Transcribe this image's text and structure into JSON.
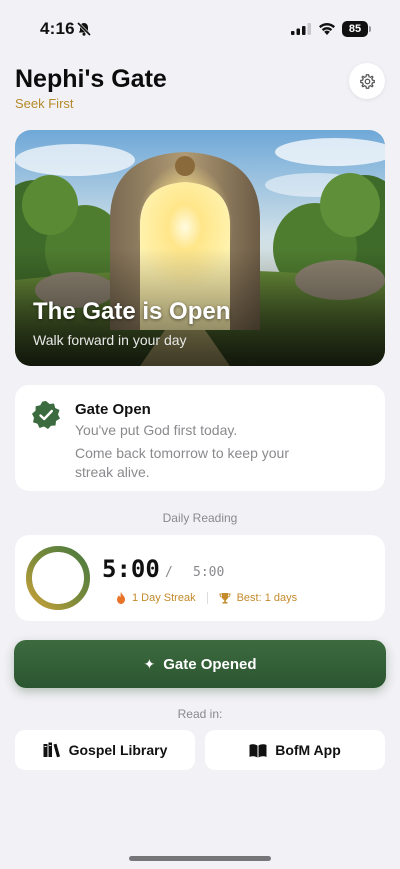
{
  "status_bar": {
    "time": "4:16",
    "battery": "85"
  },
  "header": {
    "title": "Nephi's Gate",
    "subtitle": "Seek First"
  },
  "hero": {
    "title": "The Gate is Open",
    "subtitle": "Walk forward in your day"
  },
  "status_card": {
    "title": "Gate Open",
    "line1": "You've put God first today.",
    "line2": "Come back tomorrow to keep your streak alive."
  },
  "reading": {
    "label": "Daily Reading",
    "elapsed": "5:00",
    "separator": "/",
    "goal": "5:00",
    "progress": 1.0,
    "streak": "1 Day Streak",
    "best": "Best: 1 days"
  },
  "gate_button": {
    "label": "Gate Opened"
  },
  "read_in": {
    "label": "Read in:",
    "gospel_library": "Gospel Library",
    "bofm_app": "BofM App"
  },
  "colors": {
    "accent_green": "#2f5a33",
    "gold": "#c48b2c"
  },
  "icons": [
    "bell-slash-icon",
    "signal-icon",
    "wifi-icon",
    "gear-icon",
    "check-badge-icon",
    "flame-icon",
    "trophy-icon",
    "sparkle-icon",
    "books-icon",
    "book-open-icon"
  ]
}
